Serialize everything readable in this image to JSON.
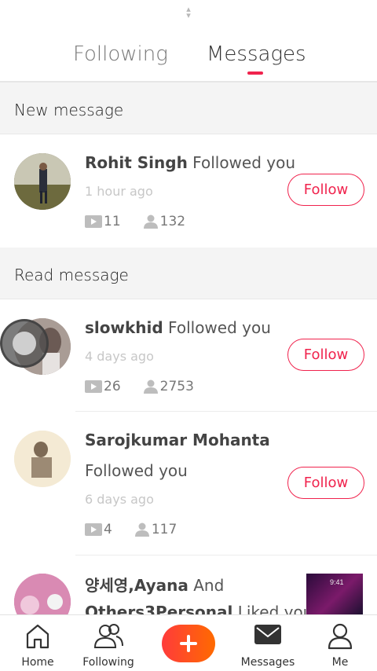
{
  "tabs": [
    {
      "label": "Following",
      "active": false
    },
    {
      "label": "Messages",
      "active": true
    }
  ],
  "sections": {
    "new": "New message",
    "read": "Read message"
  },
  "messages": [
    {
      "name": "Rohit Singh",
      "action": "Followed you",
      "time": "1 hour ago",
      "videos": "11",
      "followers": "132",
      "button": "Follow"
    },
    {
      "name": "slowkhid",
      "action": "Followed you",
      "time": "4 days ago",
      "videos": "26",
      "followers": "2753",
      "button": "Follow"
    },
    {
      "name": "Sarojkumar Mohanta",
      "action": "Followed you",
      "time": "6 days ago",
      "videos": "4",
      "followers": "117",
      "button": "Follow"
    },
    {
      "name_part1": "양세영,",
      "name_part2": "Ayana",
      "connector": " And",
      "name_part3": "Others3Personal",
      "action": " Liked your",
      "thumb_time": "9:41"
    }
  ],
  "bottom_nav": [
    {
      "label": "Home",
      "icon": "home-icon"
    },
    {
      "label": "Following",
      "icon": "people-icon"
    },
    {
      "label": "",
      "icon": "add-icon"
    },
    {
      "label": "Messages",
      "icon": "envelope-icon"
    },
    {
      "label": "Me",
      "icon": "person-icon"
    }
  ],
  "colors": {
    "accent": "#f0234d",
    "add_gradient_start": "#ff3b3b",
    "add_gradient_end": "#ff6a00"
  }
}
